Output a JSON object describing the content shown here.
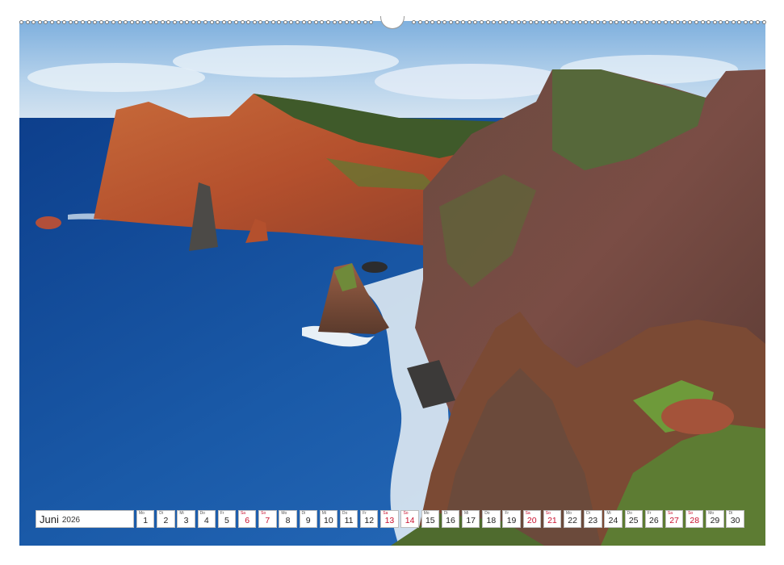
{
  "calendar": {
    "month": "Juni",
    "year": "2026",
    "days": [
      {
        "num": "1",
        "dn": "Mo",
        "weekend": false
      },
      {
        "num": "2",
        "dn": "Di",
        "weekend": false
      },
      {
        "num": "3",
        "dn": "Mi",
        "weekend": false
      },
      {
        "num": "4",
        "dn": "Do",
        "weekend": false
      },
      {
        "num": "5",
        "dn": "Fr",
        "weekend": false
      },
      {
        "num": "6",
        "dn": "Sa",
        "weekend": true
      },
      {
        "num": "7",
        "dn": "So",
        "weekend": true
      },
      {
        "num": "8",
        "dn": "Mo",
        "weekend": false
      },
      {
        "num": "9",
        "dn": "Di",
        "weekend": false
      },
      {
        "num": "10",
        "dn": "Mi",
        "weekend": false
      },
      {
        "num": "11",
        "dn": "Do",
        "weekend": false
      },
      {
        "num": "12",
        "dn": "Fr",
        "weekend": false
      },
      {
        "num": "13",
        "dn": "Sa",
        "weekend": true
      },
      {
        "num": "14",
        "dn": "So",
        "weekend": true
      },
      {
        "num": "15",
        "dn": "Mo",
        "weekend": false
      },
      {
        "num": "16",
        "dn": "Di",
        "weekend": false
      },
      {
        "num": "17",
        "dn": "Mi",
        "weekend": false
      },
      {
        "num": "18",
        "dn": "Do",
        "weekend": false
      },
      {
        "num": "19",
        "dn": "Fr",
        "weekend": false
      },
      {
        "num": "20",
        "dn": "Sa",
        "weekend": true
      },
      {
        "num": "21",
        "dn": "So",
        "weekend": true
      },
      {
        "num": "22",
        "dn": "Mo",
        "weekend": false
      },
      {
        "num": "23",
        "dn": "Di",
        "weekend": false
      },
      {
        "num": "24",
        "dn": "Mi",
        "weekend": false
      },
      {
        "num": "25",
        "dn": "Do",
        "weekend": false
      },
      {
        "num": "26",
        "dn": "Fr",
        "weekend": false
      },
      {
        "num": "27",
        "dn": "Sa",
        "weekend": true
      },
      {
        "num": "28",
        "dn": "So",
        "weekend": true
      },
      {
        "num": "29",
        "dn": "Mo",
        "weekend": false
      },
      {
        "num": "30",
        "dn": "Di",
        "weekend": false
      }
    ]
  },
  "colors": {
    "weekend": "#c8102e",
    "sea": "#1f5fa8",
    "sky": "#9cc3e6"
  },
  "photo": {
    "icon": "coastal-cliffs-photo"
  }
}
